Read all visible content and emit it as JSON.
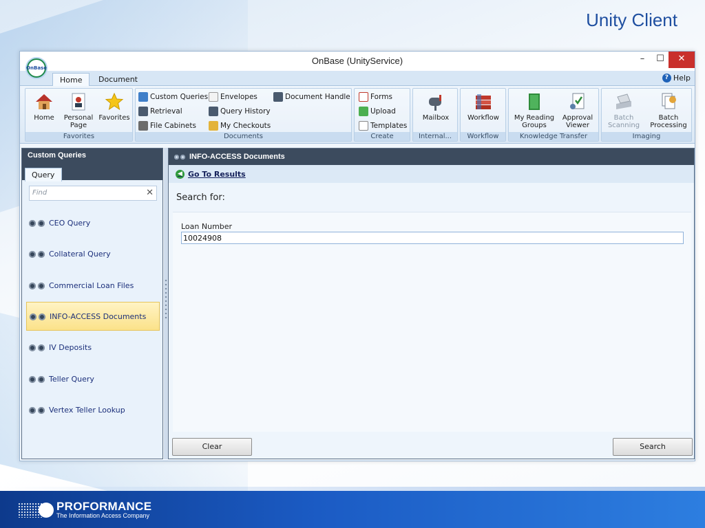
{
  "slide": {
    "title": "Unity Client",
    "footer": {
      "company": "PROFORMANCE",
      "tagline": "The Information Access Company"
    }
  },
  "window": {
    "title": "OnBase (UnityService)",
    "app_logo_text": "OnBase",
    "controls": {
      "minimize": "–",
      "maximize": "☐",
      "close": "✕"
    },
    "tabs": [
      {
        "label": "Home",
        "active": true
      },
      {
        "label": "Document",
        "active": false
      }
    ],
    "help_label": "Help"
  },
  "ribbon": {
    "groups": [
      {
        "label": "Favorites",
        "buttons": [
          {
            "label": "Home",
            "icon": "house-icon"
          },
          {
            "label": "Personal Page",
            "icon": "personal-page-icon"
          },
          {
            "label": "Favorites",
            "icon": "star-icon"
          }
        ]
      },
      {
        "label": "Documents",
        "buttons": [
          {
            "label": "Custom Queries",
            "icon": "custom-queries-icon"
          },
          {
            "label": "Retrieval",
            "icon": "retrieval-icon"
          },
          {
            "label": "File Cabinets",
            "icon": "file-cabinets-icon"
          },
          {
            "label": "Envelopes",
            "icon": "envelope-icon"
          },
          {
            "label": "Query History",
            "icon": "query-history-icon"
          },
          {
            "label": "My Checkouts",
            "icon": "checkouts-icon"
          },
          {
            "label": "Document Handle",
            "icon": "document-handle-icon"
          }
        ]
      },
      {
        "label": "Create",
        "buttons": [
          {
            "label": "Forms",
            "icon": "forms-icon"
          },
          {
            "label": "Upload",
            "icon": "upload-icon"
          },
          {
            "label": "Templates",
            "icon": "templates-icon"
          }
        ]
      },
      {
        "label": "Internal...",
        "buttons": [
          {
            "label": "Mailbox",
            "icon": "mailbox-icon"
          }
        ]
      },
      {
        "label": "Workflow",
        "buttons": [
          {
            "label": "Workflow",
            "icon": "workflow-icon"
          }
        ]
      },
      {
        "label": "Knowledge Transfer",
        "buttons": [
          {
            "label": "My Reading Groups",
            "icon": "reading-groups-icon"
          },
          {
            "label": "Approval Viewer",
            "icon": "approval-viewer-icon"
          }
        ]
      },
      {
        "label": "Imaging",
        "buttons": [
          {
            "label": "Batch Scanning",
            "icon": "scanner-icon",
            "enabled": false
          },
          {
            "label": "Batch Processing",
            "icon": "batch-processing-icon"
          }
        ]
      }
    ]
  },
  "left_panel": {
    "header": "Custom Queries",
    "tab": "Query",
    "find_placeholder": "Find",
    "queries": [
      {
        "label": "CEO Query",
        "selected": false
      },
      {
        "label": "Collateral Query",
        "selected": false
      },
      {
        "label": "Commercial Loan Files",
        "selected": false
      },
      {
        "label": "INFO-ACCESS Documents",
        "selected": true
      },
      {
        "label": "IV Deposits",
        "selected": false
      },
      {
        "label": "Teller Query",
        "selected": false
      },
      {
        "label": "Vertex Teller Lookup",
        "selected": false
      }
    ]
  },
  "right_panel": {
    "header": "INFO-ACCESS Documents",
    "go_to_results": "Go To Results",
    "search_for": "Search for:",
    "fields": [
      {
        "label": "Loan Number",
        "value": "10024908"
      }
    ],
    "clear_button": "Clear",
    "search_button": "Search"
  }
}
